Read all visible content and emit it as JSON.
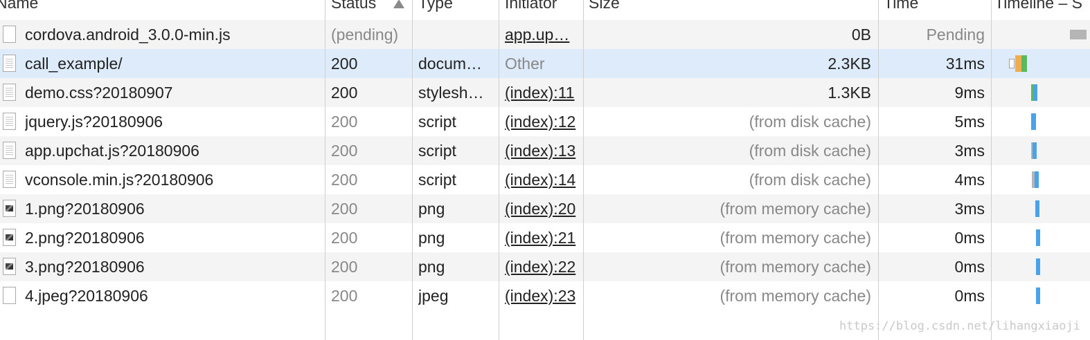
{
  "header": {
    "name": "Name",
    "status": "Status",
    "type": "Type",
    "initiator": "Initiator",
    "size": "Size",
    "time": "Time",
    "timeline": "Timeline – S"
  },
  "rows": [
    {
      "name": "cordova.android_3.0.0-min.js",
      "status": "(pending)",
      "type": "",
      "initiator": "app.up…",
      "size": "0B",
      "time": "Pending",
      "icon": "blank-file-icon"
    },
    {
      "name": "call_example/",
      "status": "200",
      "type": "docum…",
      "initiator": "Other",
      "size": "2.3KB",
      "time": "31ms",
      "icon": "document-file-icon"
    },
    {
      "name": "demo.css?20180907",
      "status": "200",
      "type": "stylesh…",
      "initiator": "(index):11",
      "size": "1.3KB",
      "time": "9ms",
      "icon": "document-file-icon"
    },
    {
      "name": "jquery.js?20180906",
      "status": "200",
      "type": "script",
      "initiator": "(index):12",
      "size": "(from disk cache)",
      "time": "5ms",
      "icon": "document-file-icon"
    },
    {
      "name": "app.upchat.js?20180906",
      "status": "200",
      "type": "script",
      "initiator": "(index):13",
      "size": "(from disk cache)",
      "time": "3ms",
      "icon": "document-file-icon"
    },
    {
      "name": "vconsole.min.js?20180906",
      "status": "200",
      "type": "script",
      "initiator": "(index):14",
      "size": "(from disk cache)",
      "time": "4ms",
      "icon": "document-file-icon"
    },
    {
      "name": "1.png?20180906",
      "status": "200",
      "type": "png",
      "initiator": "(index):20",
      "size": "(from memory cache)",
      "time": "3ms",
      "icon": "image-file-icon"
    },
    {
      "name": "2.png?20180906",
      "status": "200",
      "type": "png",
      "initiator": "(index):21",
      "size": "(from memory cache)",
      "time": "0ms",
      "icon": "image-file-icon"
    },
    {
      "name": "3.png?20180906",
      "status": "200",
      "type": "png",
      "initiator": "(index):22",
      "size": "(from memory cache)",
      "time": "0ms",
      "icon": "image-file-icon"
    },
    {
      "name": "4.jpeg?20180906",
      "status": "200",
      "type": "jpeg",
      "initiator": "(index):23",
      "size": "(from memory cache)",
      "time": "0ms",
      "icon": "blank-file-icon"
    }
  ],
  "watermark": "https://blog.csdn.net/lihangxiaoji",
  "colors": {
    "selected_row": "#deebfb",
    "alt_row": "#f4f4f4",
    "timeline_blue": "#4aa3e8",
    "timeline_green": "#5cb85c",
    "timeline_orange": "#f0ad4e",
    "timeline_pending": "#b5b5b5"
  }
}
